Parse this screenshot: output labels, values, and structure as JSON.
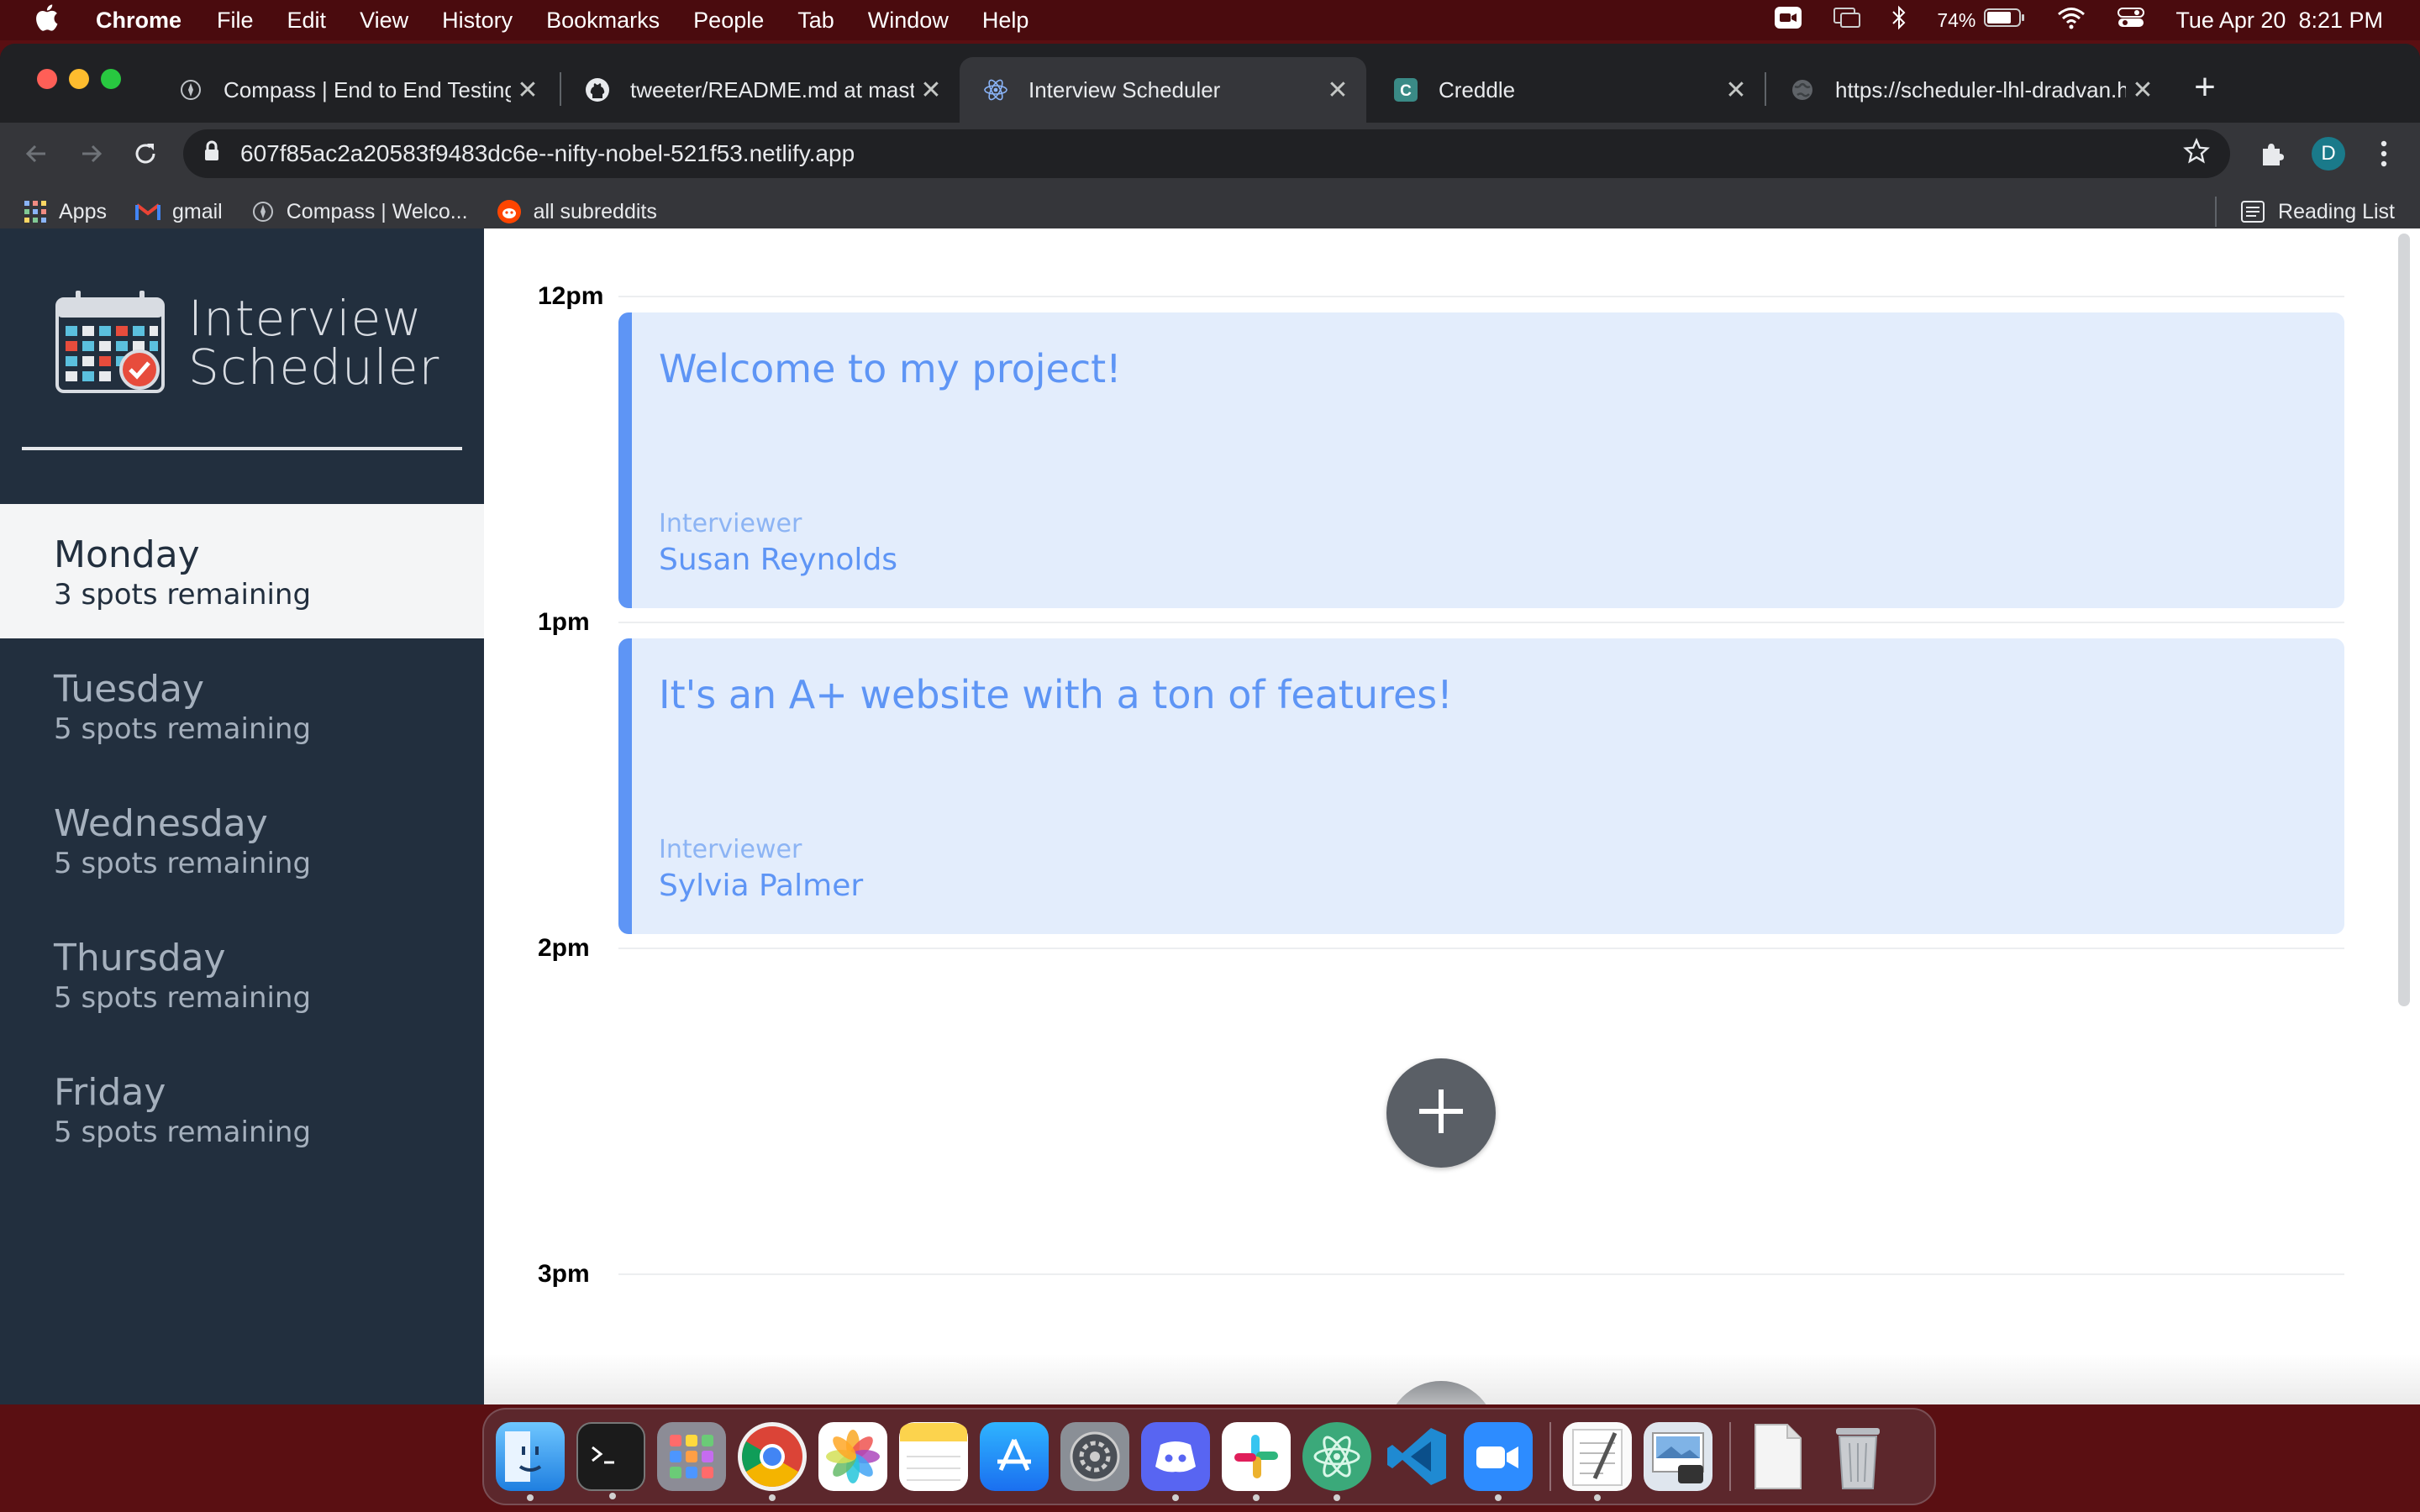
{
  "menubar": {
    "app_name": "Chrome",
    "menus": [
      "File",
      "Edit",
      "View",
      "History",
      "Bookmarks",
      "People",
      "Tab",
      "Window",
      "Help"
    ],
    "battery": "74%",
    "datetime": "Tue Apr 20  8:21 PM"
  },
  "browser": {
    "tabs": [
      {
        "title": "Compass | End to End Testing",
        "icon": "compass-icon",
        "active": false
      },
      {
        "title": "tweeter/README.md at master",
        "icon": "github-icon",
        "active": false
      },
      {
        "title": "Interview Scheduler",
        "icon": "react-icon",
        "active": true
      },
      {
        "title": "Creddle",
        "icon": "creddle-icon",
        "active": false
      },
      {
        "title": "https://scheduler-lhl-dradvan.h",
        "icon": "globe-icon",
        "active": false
      }
    ],
    "url": "607f85ac2a20583f9483dc6e--nifty-nobel-521f53.netlify.app",
    "profile_initial": "D",
    "bookmarks": [
      {
        "label": "Apps",
        "icon": "apps-grid-icon"
      },
      {
        "label": "gmail",
        "icon": "gmail-icon"
      },
      {
        "label": "Compass | Welco...",
        "icon": "compass-icon"
      },
      {
        "label": "all subreddits",
        "icon": "reddit-icon"
      }
    ],
    "reading_list": "Reading List"
  },
  "app": {
    "logo_line1": "Interview",
    "logo_line2": "Scheduler",
    "days": [
      {
        "name": "Monday",
        "spots": "3 spots remaining",
        "selected": true
      },
      {
        "name": "Tuesday",
        "spots": "5 spots remaining",
        "selected": false
      },
      {
        "name": "Wednesday",
        "spots": "5 spots remaining",
        "selected": false
      },
      {
        "name": "Thursday",
        "spots": "5 spots remaining",
        "selected": false
      },
      {
        "name": "Friday",
        "spots": "5 spots remaining",
        "selected": false
      }
    ],
    "hours": [
      "12pm",
      "1pm",
      "2pm",
      "3pm"
    ],
    "appointments": [
      {
        "student": "Welcome to my project!",
        "interviewer_label": "Interviewer",
        "interviewer": "Susan Reynolds"
      },
      {
        "student": "It's an A+ website with a ton of features!",
        "interviewer_label": "Interviewer",
        "interviewer": "Sylvia Palmer"
      }
    ]
  },
  "dock": {
    "apps": [
      "finder-icon",
      "terminal-icon",
      "launchpad-icon",
      "chrome-icon",
      "photos-icon",
      "notes-icon",
      "app-store-icon",
      "system-preferences-icon",
      "discord-icon",
      "slack-icon",
      "atom-icon",
      "vscode-icon",
      "zoom-icon",
      "textedit-icon",
      "preview-icon",
      "pdf-document-icon",
      "trash-icon"
    ]
  },
  "colors": {
    "sidebar_bg": "#222f3e",
    "appointment_bg": "#e3edfc",
    "appointment_accent": "#5e95f5",
    "add_button": "#5a5f66"
  }
}
